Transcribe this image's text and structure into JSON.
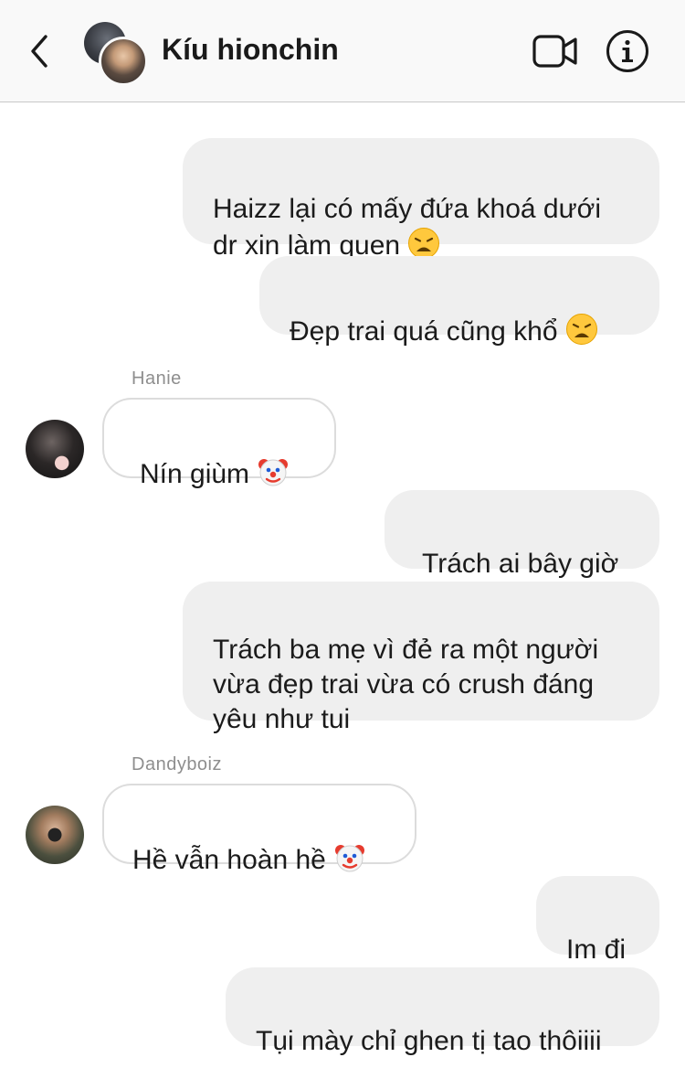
{
  "header": {
    "title": "Kíu hionchin",
    "back_icon": "chevron-left-icon",
    "video_icon": "video-camera-icon",
    "info_icon": "info-icon"
  },
  "messages": [
    {
      "side": "out",
      "text": "Haizz lại có mấy đứa khoá dưới\ndr xin làm quen",
      "emoji": "weary-face"
    },
    {
      "side": "out",
      "text": "Đẹp trai quá cũng khổ",
      "emoji": "weary-face"
    },
    {
      "side": "in",
      "sender": "Hanie",
      "text": "Nín giùm",
      "emoji": "clown-face"
    },
    {
      "side": "out",
      "text": "Trách ai bây giờ"
    },
    {
      "side": "out",
      "text": "Trách ba mẹ vì đẻ ra một người\nvừa đẹp trai vừa có crush đáng\nyêu như tui"
    },
    {
      "side": "in",
      "sender": "Dandyboiz",
      "text": "Hề vẫn hoàn hề",
      "emoji": "clown-face"
    },
    {
      "side": "out",
      "text": "Im đi"
    },
    {
      "side": "out",
      "text": "Tụi mày chỉ ghen tị tao thôiiii"
    }
  ]
}
